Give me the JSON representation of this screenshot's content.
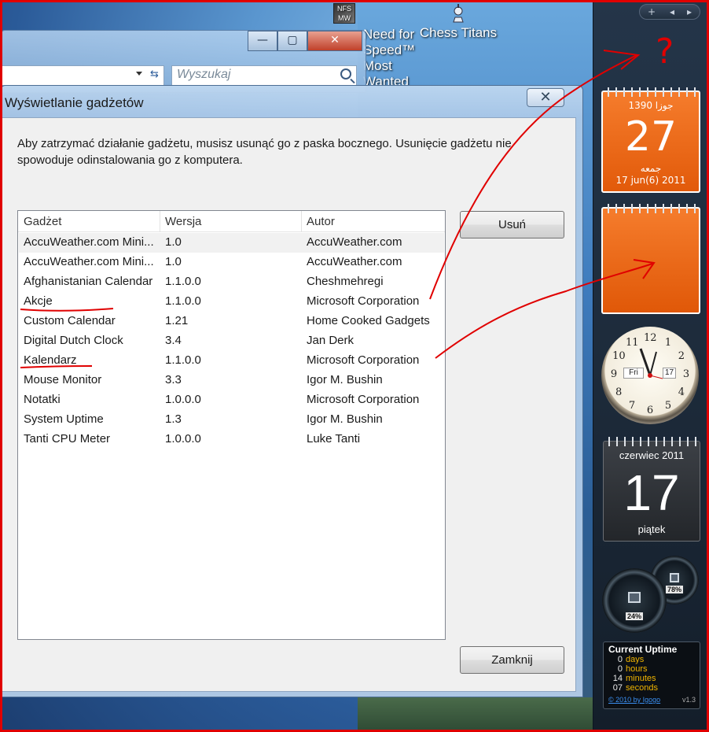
{
  "desktop": {
    "icons": [
      {
        "label": "Need for Speed™",
        "sub": "Most Wanted",
        "ico": "NFS MW"
      },
      {
        "label": "Chess Titans"
      }
    ]
  },
  "explorer": {
    "search_placeholder": "Wyszukaj",
    "min": "—",
    "max": "▢",
    "close": "✕"
  },
  "dialog": {
    "title": "Wyświetlanie gadżetów",
    "close_label": "✕",
    "description": "Aby zatrzymać działanie gadżetu, musisz usunąć go z paska bocznego. Usunięcie gadżetu nie spowoduje odinstalowania go z komputera.",
    "columns": [
      "Gadżet",
      "Wersja",
      "Autor"
    ],
    "rows": [
      [
        "AccuWeather.com Mini...",
        "1.0",
        "AccuWeather.com"
      ],
      [
        "AccuWeather.com Mini...",
        "1.0",
        "AccuWeather.com"
      ],
      [
        "Afghanistanian Calendar",
        "1.1.0.0",
        "Cheshmehregi"
      ],
      [
        "Akcje",
        "1.1.0.0",
        "Microsoft Corporation"
      ],
      [
        "Custom Calendar",
        "1.21",
        "Home Cooked Gadgets"
      ],
      [
        "Digital Dutch Clock",
        "3.4",
        "Jan Derk"
      ],
      [
        "Kalendarz",
        "1.1.0.0",
        "Microsoft Corporation"
      ],
      [
        "Mouse Monitor",
        "3.3",
        "Igor M. Bushin"
      ],
      [
        "Notatki",
        "1.0.0.0",
        "Microsoft Corporation"
      ],
      [
        "System Uptime",
        "1.3",
        "Igor M. Bushin"
      ],
      [
        "Tanti CPU Meter",
        "1.0.0.0",
        "Luke Tanti"
      ]
    ],
    "remove_label": "Usuń",
    "close_button_label": "Zamknij"
  },
  "sidebar": {
    "controls": [
      "+",
      "◂",
      "▸"
    ],
    "afghan_calendar": {
      "top": "1390 جوزا",
      "day": "27",
      "weekday": "جمعه",
      "date": "17 jun(6) 2011"
    },
    "clock": {
      "numbers": [
        "12",
        "1",
        "2",
        "3",
        "4",
        "5",
        "6",
        "7",
        "8",
        "9",
        "10",
        "11"
      ],
      "day_label": "Fri",
      "date_label": "17"
    },
    "calendar": {
      "month": "czerwiec 2011",
      "day": "17",
      "weekday": "piątek"
    },
    "cpu_meter": {
      "cpu": "24%",
      "mem": "78%"
    },
    "uptime": {
      "title": "Current Uptime",
      "rows": [
        {
          "n": "0",
          "u": "days"
        },
        {
          "n": "0",
          "u": "hours"
        },
        {
          "n": "14",
          "u": "minutes"
        },
        {
          "n": "07",
          "u": "seconds"
        }
      ],
      "footer": "© 2010 by Igogo",
      "version": "v1.3"
    }
  },
  "annotation": {
    "mark": "?"
  },
  "colors": {
    "annotation": "#e00000",
    "calendar_orange": "#f06a1c",
    "selection": "#f1f1f1"
  }
}
